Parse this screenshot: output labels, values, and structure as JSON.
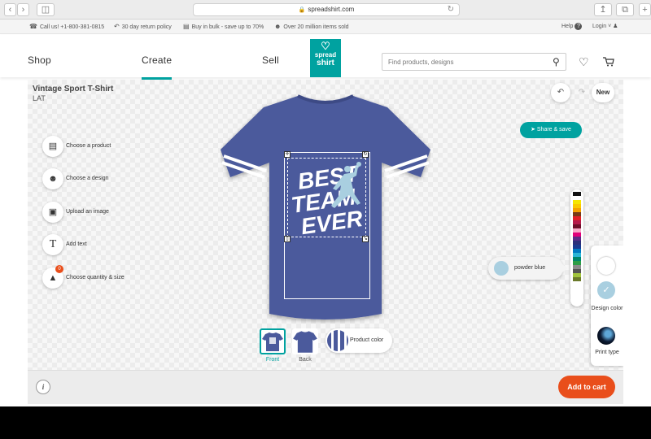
{
  "browser": {
    "url": "spreadshirt.com"
  },
  "topbar": {
    "call": "Call us! +1-800-381-0815",
    "returns": "30 day return policy",
    "bulk": "Buy in bulk - save up to 70%",
    "sold": "Over 20 million items sold",
    "help": "Help",
    "login": "Login"
  },
  "nav": {
    "shop": "Shop",
    "create": "Create",
    "sell": "Sell"
  },
  "logo": {
    "line1": "spread",
    "line2": "shirt"
  },
  "search": {
    "placeholder": "Find products, designs"
  },
  "product": {
    "name": "Vintage Sport T-Shirt",
    "brand": "LAT",
    "color": "#4b5a9c",
    "stripe_color": "#ffffff"
  },
  "design": {
    "line1": "BEST",
    "line2": "TEAM",
    "line3": "EVER.",
    "text_color": "#ffffff",
    "figure_color": "#a9cfe0"
  },
  "toolbar": {
    "new": "New",
    "share": "Share & save"
  },
  "tools": [
    {
      "label": "Choose a product",
      "icon": "shirt-stack-icon"
    },
    {
      "label": "Choose a design",
      "icon": "smiley-icon"
    },
    {
      "label": "Upload an image",
      "icon": "image-upload-icon"
    },
    {
      "label": "Add text",
      "icon": "text-icon"
    },
    {
      "label": "Choose quantity & size",
      "icon": "shirt-quantity-icon",
      "badge": "0"
    }
  ],
  "views": {
    "front": "Front",
    "back": "Back",
    "product_color": "Product color"
  },
  "color_tooltip": {
    "name": "powder blue",
    "hex": "#a9cfe0"
  },
  "palette": [
    "#111111",
    "#ffffff",
    "#f6e600",
    "#f9c900",
    "#f5a100",
    "#7a3b16",
    "#e12027",
    "#b51a4b",
    "#6d0f2a",
    "#f6a9c8",
    "#e2007a",
    "#5a2b86",
    "#2b2f7a",
    "#1a3a8f",
    "#0079c1",
    "#2bb5d6",
    "#00866b",
    "#2e9e47",
    "#8b8b8b",
    "#555555",
    "#a2c43d",
    "#6b7a2b"
  ],
  "side_panel": {
    "design_color": "Design color",
    "print_type": "Print type"
  },
  "cart": {
    "add": "Add to cart"
  },
  "accent": "#00a2a0",
  "cta_color": "#e94e1b"
}
